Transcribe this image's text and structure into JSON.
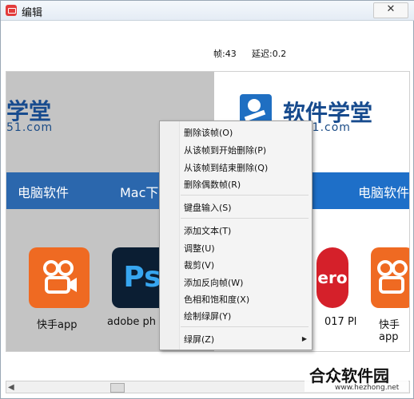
{
  "window": {
    "title": "编辑",
    "close_label": "✕"
  },
  "stats": {
    "frame": "帧:43",
    "delay": "延迟:0.2"
  },
  "canvas": {
    "prev_frame": {
      "logo_text": "学堂",
      "url_text": "51.com",
      "nav_items": [
        "电脑软件",
        "Mac下"
      ],
      "apps": [
        {
          "label": "快手app",
          "icon": "kuaishou-icon"
        },
        {
          "label": "adobe ph",
          "icon": "photoshop-icon",
          "text": "Ps"
        }
      ]
    },
    "current_frame": {
      "logo_text": "软件学堂",
      "url_text": "xue51.com",
      "nav_items": [
        "电脑软件"
      ],
      "apps": [
        {
          "label": "017 Pl",
          "icon": "pro-icon",
          "text": "ero"
        },
        {
          "label": "快手app",
          "icon": "kuaishou-icon"
        }
      ]
    }
  },
  "context_menu": {
    "items": [
      {
        "label": "删除该帧(O)"
      },
      {
        "label": "从该帧到开始删除(P)"
      },
      {
        "label": "从该帧到结束删除(Q)"
      },
      {
        "label": "删除偶数帧(R)"
      },
      {
        "label": "键盘输入(S)"
      },
      {
        "label": "添加文本(T)"
      },
      {
        "label": "调整(U)"
      },
      {
        "label": "裁剪(V)"
      },
      {
        "label": "添加反向帧(W)"
      },
      {
        "label": "色相和饱和度(X)"
      },
      {
        "label": "绘制绿屏(Y)"
      },
      {
        "label": "绿屏(Z)"
      }
    ],
    "submenu_arrow": "▶"
  },
  "scrollbar": {
    "left_arrow": "◀"
  },
  "watermark": {
    "main": "合众软件园",
    "url": "www.hezhong.net"
  },
  "colors": {
    "nav_blue": "#1e6fc8",
    "kuaishou_orange": "#ef6a22",
    "menu_bg": "#f4f4f4"
  }
}
